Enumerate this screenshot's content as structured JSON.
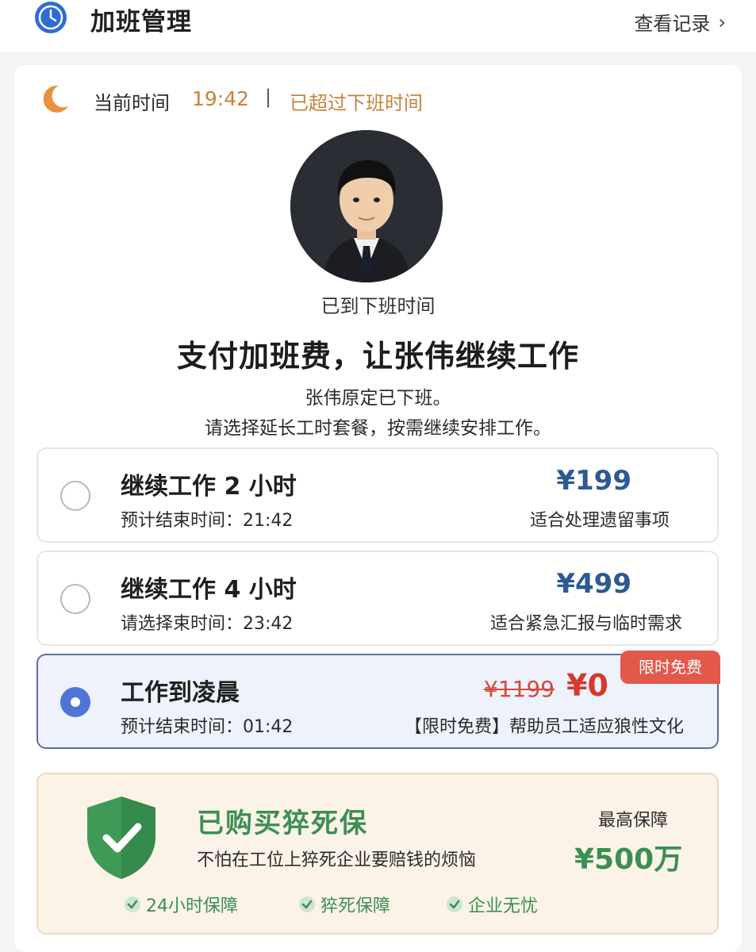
{
  "header": {
    "title": "加班管理",
    "records_link": "查看记录",
    "chevron": "›"
  },
  "status": {
    "label": "当前时间",
    "time": "19:42",
    "separator": "|",
    "message": "已超过下班时间"
  },
  "profile": {
    "arrived_text": "已到下班时间",
    "headline": "支付加班费，让张伟继续工作",
    "desc_line1": "张伟原定已下班。",
    "desc_line2": "请选择延长工时套餐，按需继续安排工作。"
  },
  "options": [
    {
      "title": "继续工作 2 小时",
      "end_time": "预计结束时间：21:42",
      "price": "¥199",
      "note": "适合处理遗留事项",
      "selected": false
    },
    {
      "title": "继续工作 4 小时",
      "end_time": "请选择束时间：23:42",
      "price": "¥499",
      "note": "适合紧急汇报与临时需求",
      "selected": false
    },
    {
      "title": "工作到凌晨",
      "end_time": "预计结束时间：01:42",
      "original_price": "¥1199",
      "price": "¥0",
      "badge": "限时免费",
      "note": "【限时免费】帮助员工适应狼性文化",
      "selected": true
    }
  ],
  "insurance": {
    "title": "已购买猝死保",
    "subtitle": "不怕在工位上猝死企业要赔钱的烦恼",
    "max_label": "最高保障",
    "amount": "¥500万",
    "features": [
      "24小时保障",
      "猝死保障",
      "企业无忧"
    ]
  },
  "colors": {
    "accent_blue": "#2e5a92",
    "warning_orange": "#c8823a",
    "free_red": "#d7392e",
    "insurance_green": "#3b8f52",
    "selected_radio": "#5074d6"
  },
  "icons": {
    "header": "clock-icon",
    "status": "moon-icon",
    "insurance": "shield-check-icon",
    "feature": "check-circle-icon"
  }
}
